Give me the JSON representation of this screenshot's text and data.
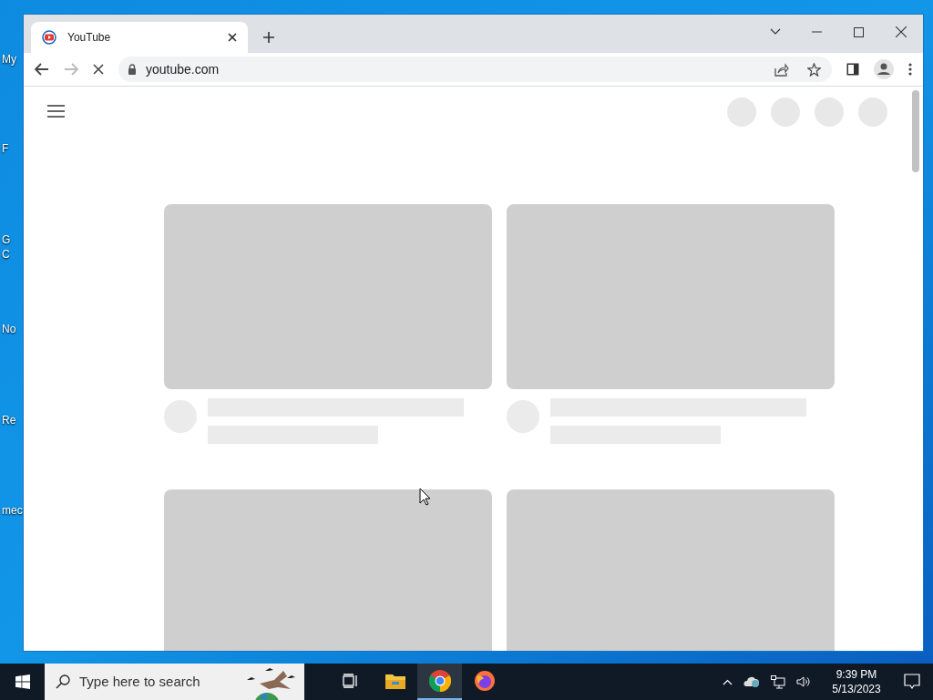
{
  "desktop": {
    "icons": [
      {
        "label": "My"
      },
      {
        "label": "F"
      },
      {
        "label": "G"
      },
      {
        "label": "C"
      },
      {
        "label": "No"
      },
      {
        "label": "Re"
      },
      {
        "label": "mec"
      }
    ]
  },
  "browser": {
    "tab": {
      "title": "YouTube",
      "selected": true
    },
    "loading": true,
    "address": "youtube.com"
  },
  "taskbar": {
    "search": {
      "placeholder": "Type here to search"
    },
    "apps": [
      {
        "kind": "taskview",
        "selected": false
      },
      {
        "kind": "explorer",
        "selected": false
      },
      {
        "kind": "chrome",
        "selected": true
      },
      {
        "kind": "firefox",
        "selected": false
      }
    ],
    "time": "9:39 PM",
    "date": "5/13/2023"
  }
}
